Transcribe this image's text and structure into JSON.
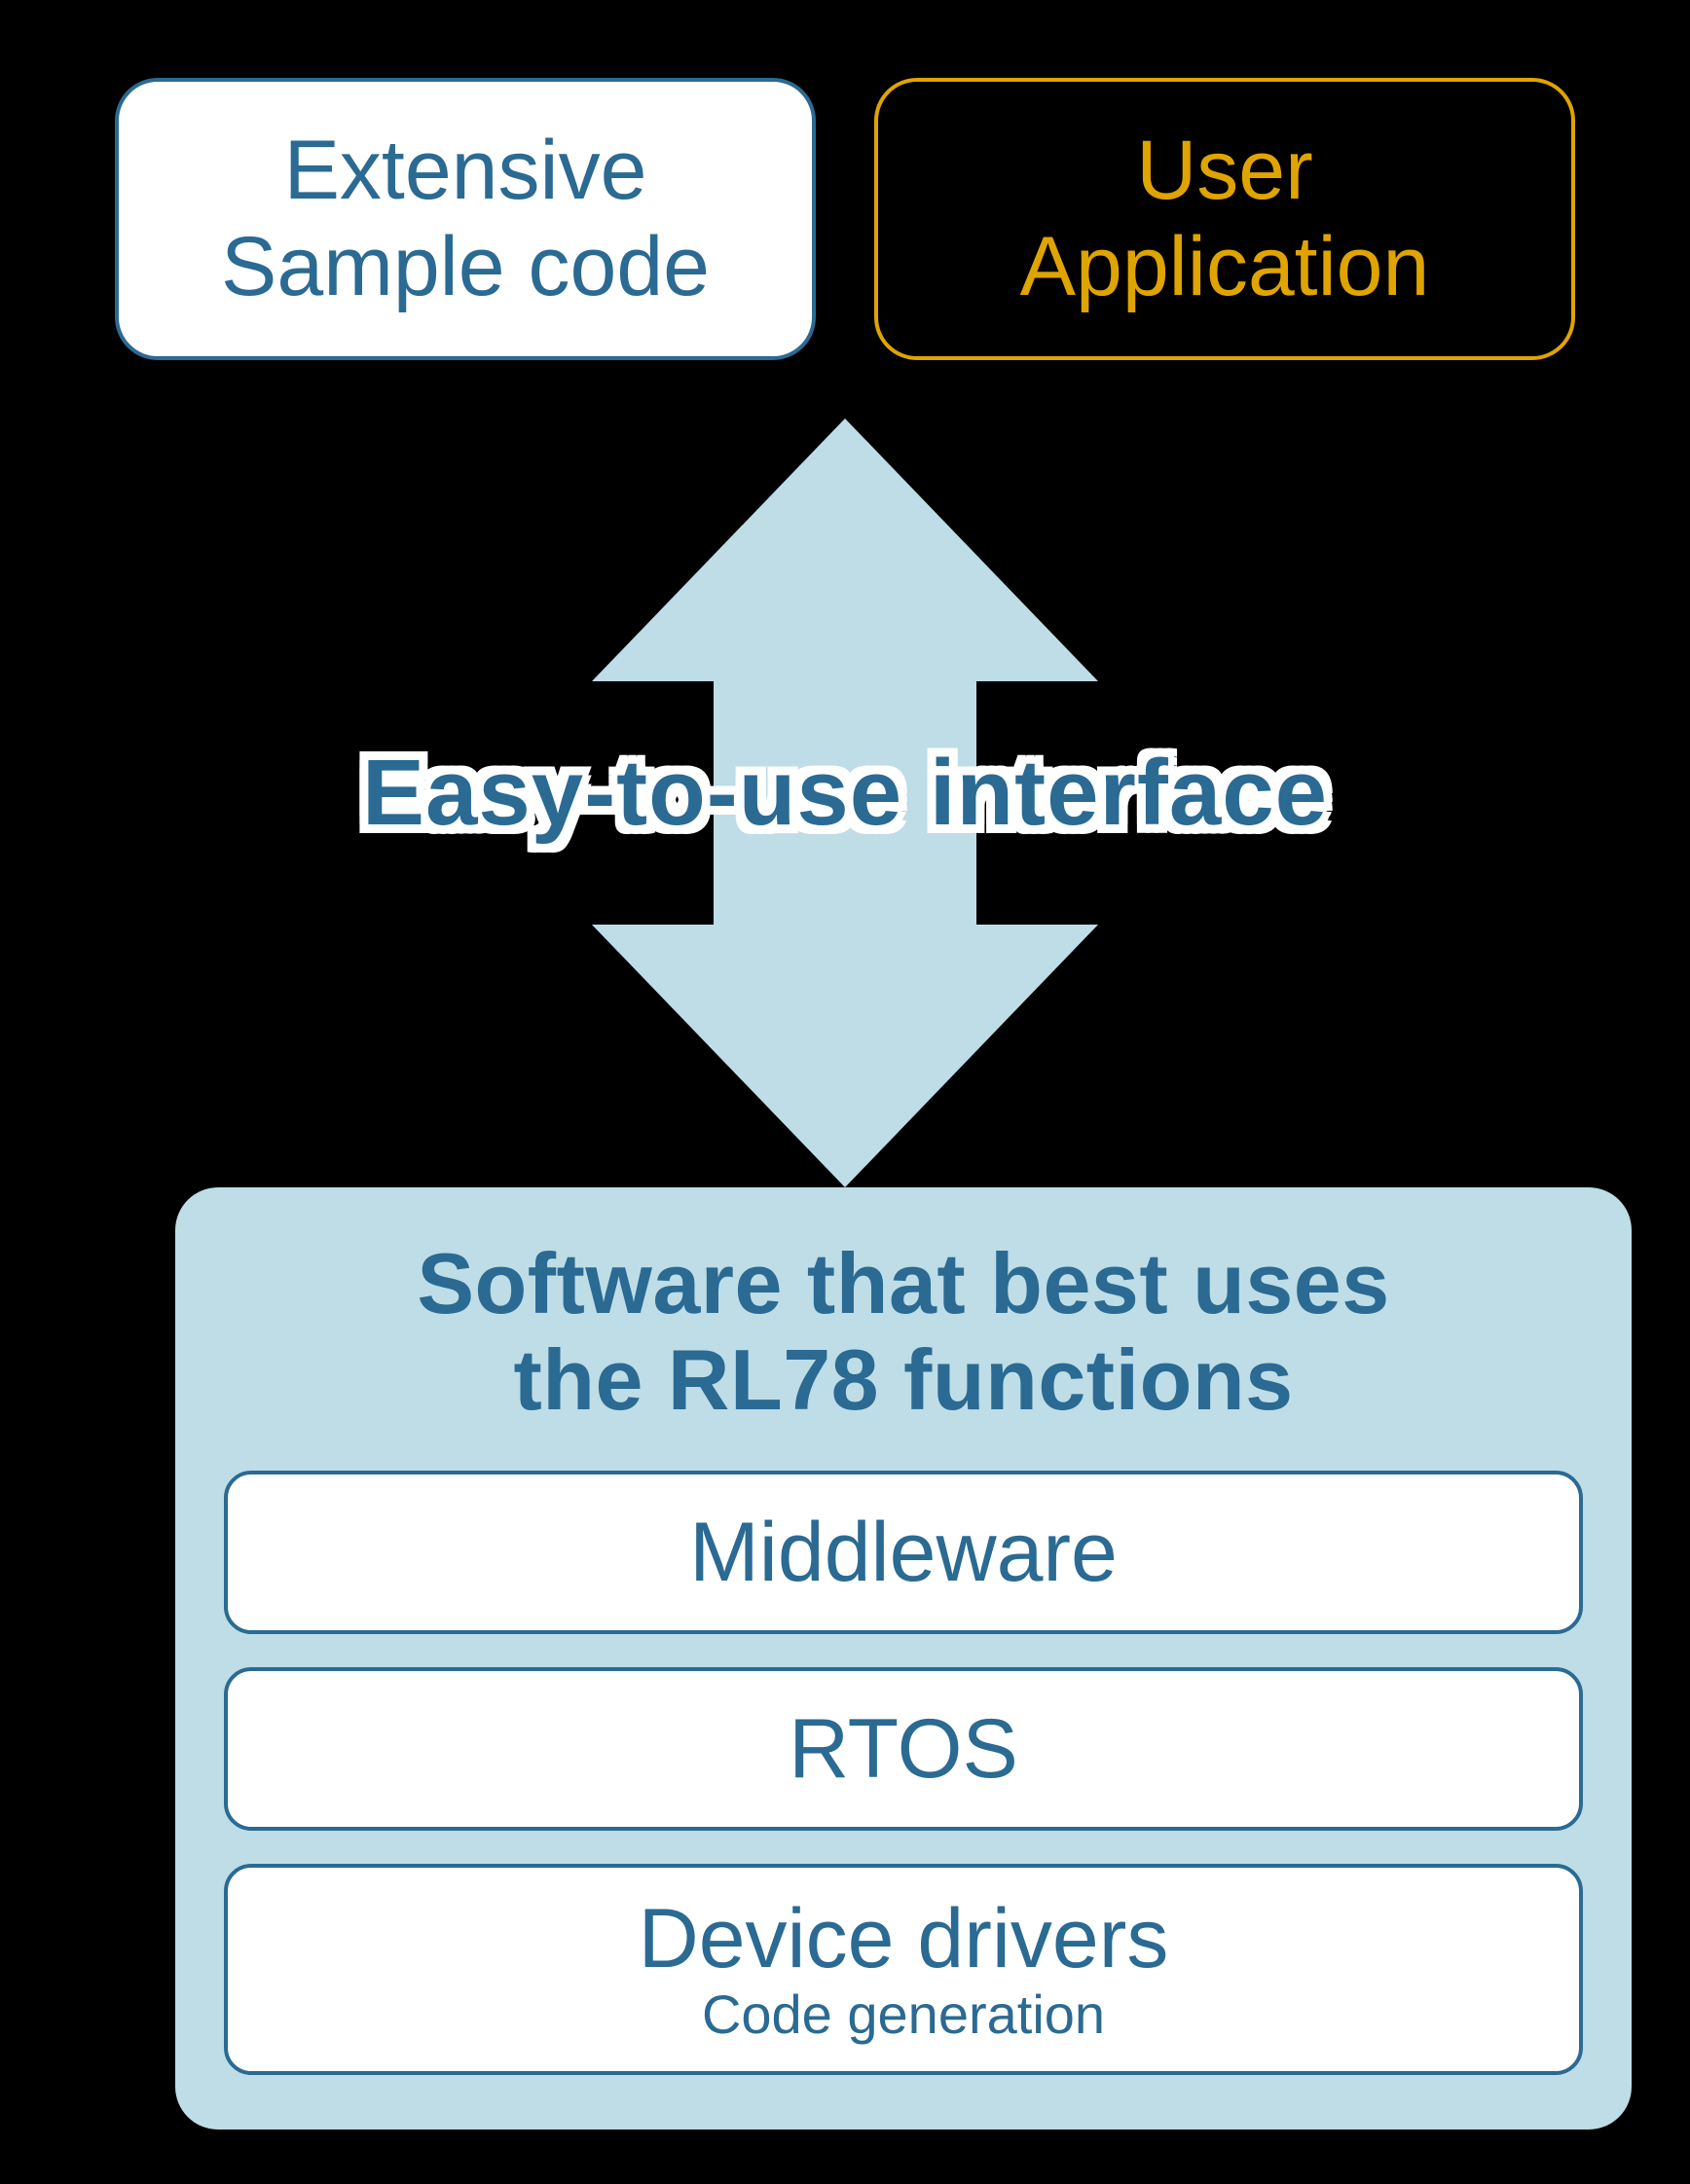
{
  "colors": {
    "blue": "#2a6a93",
    "light_blue": "#bedde6",
    "gold": "#e0a400",
    "white": "#ffffff",
    "black": "#000000"
  },
  "top": {
    "sample_l1": "Extensive",
    "sample_l2": "Sample code",
    "user_l1": "User",
    "user_l2": "Application"
  },
  "interface_label": "Easy-to-use interface",
  "software_panel": {
    "heading_l1": "Software that best uses",
    "heading_l2": "the RL78 functions",
    "items": {
      "middleware": "Middleware",
      "rtos": "RTOS",
      "drivers_title": "Device drivers",
      "drivers_sub": "Code generation"
    }
  }
}
